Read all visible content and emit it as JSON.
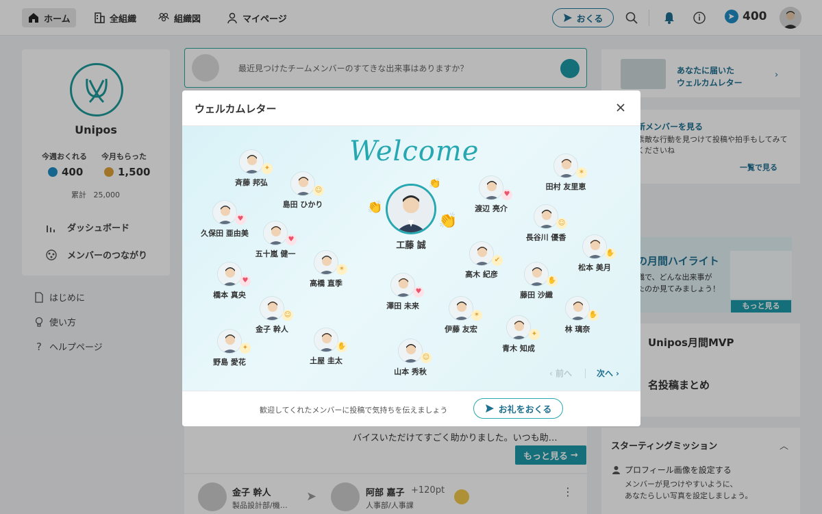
{
  "nav": {
    "home": "ホーム",
    "all_org": "全組織",
    "org_chart": "組織図",
    "mypage": "マイページ",
    "send": "おくる",
    "points": "400"
  },
  "sidebar": {
    "org_name": "Unipos",
    "week_label": "今週おくれる",
    "month_label": "今月もらった",
    "week_points": "400",
    "month_points": "1,500",
    "total_label": "累計",
    "total_value": "25,000",
    "links": [
      "ダッシュボード",
      "メンバーのつながり"
    ],
    "sub_links": [
      "はじめに",
      "使い方",
      "ヘルプページ"
    ]
  },
  "feed": {
    "placeholder": "最近見つけたチームメンバーのすてきな出来事はありますか？",
    "post_text": "バイスいただけてすごく助かりました。いつも助…",
    "more": "もっと見る",
    "sender_name": "金子 幹人",
    "sender_dept": "製品設計部/機…",
    "receiver_name": "阿部 嘉子",
    "receiver_points": "+120pt",
    "receiver_dept": "人事部/人事課"
  },
  "right": {
    "welcome_letter": "あなたに届いた\nウェルカムレター",
    "new_member_title": "新メンバーを見る",
    "new_member_desc": "素敵な行動を見つけて投稿や拍手もしてみてくださいね",
    "list_link": "一覧で見る",
    "highlight_title": "の月間ハイライト",
    "highlight_desc": "職で、どんな出来事が\nたのか見てみましょう！",
    "highlight_more": "もっと見る",
    "mvp": "Unipos月間MVP",
    "summary": "名投稿まとめ",
    "mission_title": "スターティングミッション",
    "mission_item": "プロフィール画像を設定する",
    "mission_desc": "メンバーが見つけやすいように、\nあなたらしい写真を設定しましょう。"
  },
  "modal": {
    "title": "ウェルカムレター",
    "welcome": "Welcome",
    "main_member": "工藤 誠",
    "members": [
      {
        "name": "斉藤 邦弘",
        "badge": "megaphone-icon"
      },
      {
        "name": "島田 ひかり",
        "badge": "smile-icon"
      },
      {
        "name": "渡辺 亮介",
        "badge": "heart-icon"
      },
      {
        "name": "田村 友里恵",
        "badge": "party-icon"
      },
      {
        "name": "久保田 亜由美",
        "badge": "heart-icon"
      },
      {
        "name": "五十嵐 健一",
        "badge": "heart-icon"
      },
      {
        "name": "長谷川 優香",
        "badge": "smile-icon"
      },
      {
        "name": "松本 美月",
        "badge": "hands-icon"
      },
      {
        "name": "高橋 直季",
        "badge": "party-icon"
      },
      {
        "name": "高木 紀彦",
        "badge": "thumb-icon"
      },
      {
        "name": "橋本 真央",
        "badge": "heart-icon"
      },
      {
        "name": "澤田 未来",
        "badge": "heart-icon"
      },
      {
        "name": "藤田 沙織",
        "badge": "hands-icon"
      },
      {
        "name": "金子 幹人",
        "badge": "smile-icon"
      },
      {
        "name": "伊藤 友宏",
        "badge": "party-icon"
      },
      {
        "name": "林 璃奈",
        "badge": "hands-icon"
      },
      {
        "name": "野島 愛花",
        "badge": "megaphone-icon"
      },
      {
        "name": "土屋 圭太",
        "badge": "hands-icon"
      },
      {
        "name": "山本 秀秋",
        "badge": "smile-icon"
      },
      {
        "name": "青木 知成",
        "badge": "megaphone-icon"
      }
    ],
    "prev": "前へ",
    "next": "次へ",
    "footer_text": "歓迎してくれたメンバーに投稿で気持ちを伝えましょう",
    "thanks_button": "お礼をおくる"
  },
  "colors": {
    "accent": "#27a7b0",
    "brand_blue": "#1f6f90",
    "heart": "#e8556d",
    "gold": "#f2b134"
  }
}
